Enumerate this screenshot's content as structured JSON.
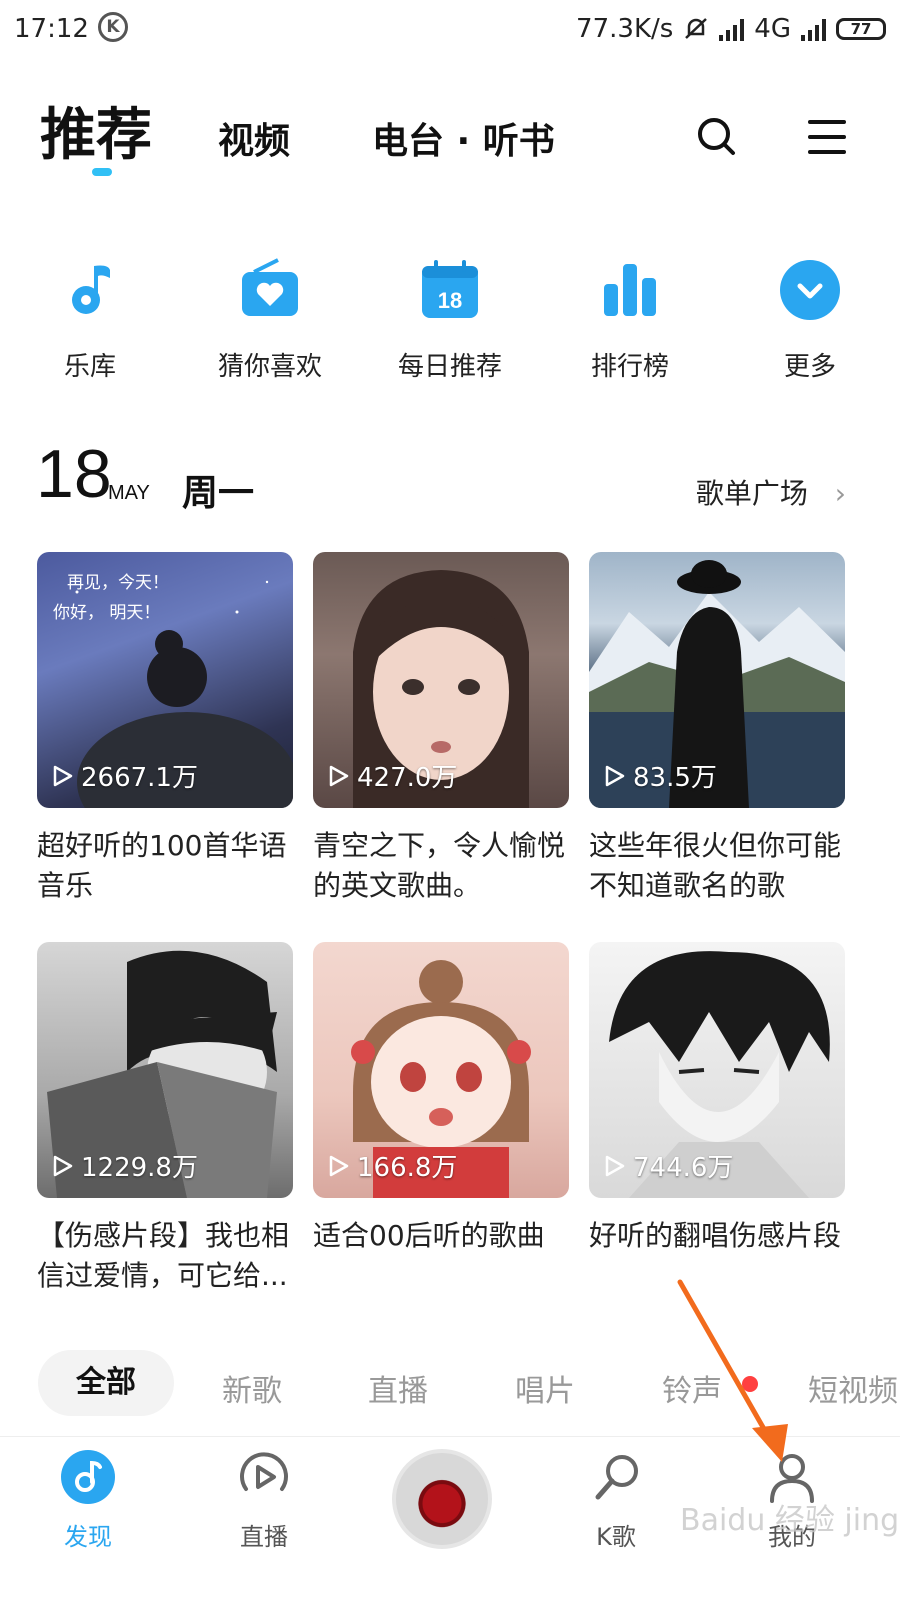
{
  "status": {
    "time": "17:12",
    "k_badge": "K",
    "net_speed": "77.3K/s",
    "network": "4G",
    "battery": "77"
  },
  "topnav": {
    "tabs": [
      {
        "label": "推荐",
        "active": true
      },
      {
        "label": "视频"
      },
      {
        "label": "电台 · 听书"
      }
    ],
    "accent": "#31c0f5"
  },
  "shortcuts": [
    {
      "label": "乐库",
      "icon": "music-note-icon"
    },
    {
      "label": "猜你喜欢",
      "icon": "heart-radio-icon"
    },
    {
      "label": "每日推荐",
      "icon": "calendar-icon",
      "badge": "18"
    },
    {
      "label": "排行榜",
      "icon": "bar-chart-icon"
    },
    {
      "label": "更多",
      "icon": "chevron-down-icon"
    }
  ],
  "date": {
    "day": "18",
    "month": "MAY",
    "weekday": "周一",
    "plaza_link": "歌单广场"
  },
  "playlists": [
    {
      "title": "超好听的100首华语音乐",
      "plays": "2667.1万",
      "cover_text": [
        "再见，今天！",
        "你好，  明天！"
      ]
    },
    {
      "title": "青空之下，令人愉悦的英文歌曲。",
      "plays": "427.0万"
    },
    {
      "title": "这些年很火但你可能不知道歌名的歌",
      "plays": "83.5万"
    },
    {
      "title": "【伤感片段】我也相信过爱情，可它给...",
      "plays": "1229.8万"
    },
    {
      "title": "适合00后听的歌曲",
      "plays": "166.8万"
    },
    {
      "title": "好听的翻唱伤感片段",
      "plays": "744.6万"
    }
  ],
  "categories": [
    {
      "label": "全部",
      "active": true
    },
    {
      "label": "新歌"
    },
    {
      "label": "直播"
    },
    {
      "label": "唱片"
    },
    {
      "label": "铃声"
    },
    {
      "label": "短视频"
    }
  ],
  "bottom_nav": [
    {
      "label": "发现",
      "icon": "discover-icon",
      "active": true
    },
    {
      "label": "直播",
      "icon": "live-play-icon"
    },
    {
      "label": "",
      "icon": "now-playing-disc"
    },
    {
      "label": "K歌",
      "icon": "microphone-icon"
    },
    {
      "label": "我的",
      "icon": "profile-icon"
    }
  ],
  "watermark": "Baidu 经验 jingyan.baidu.com"
}
